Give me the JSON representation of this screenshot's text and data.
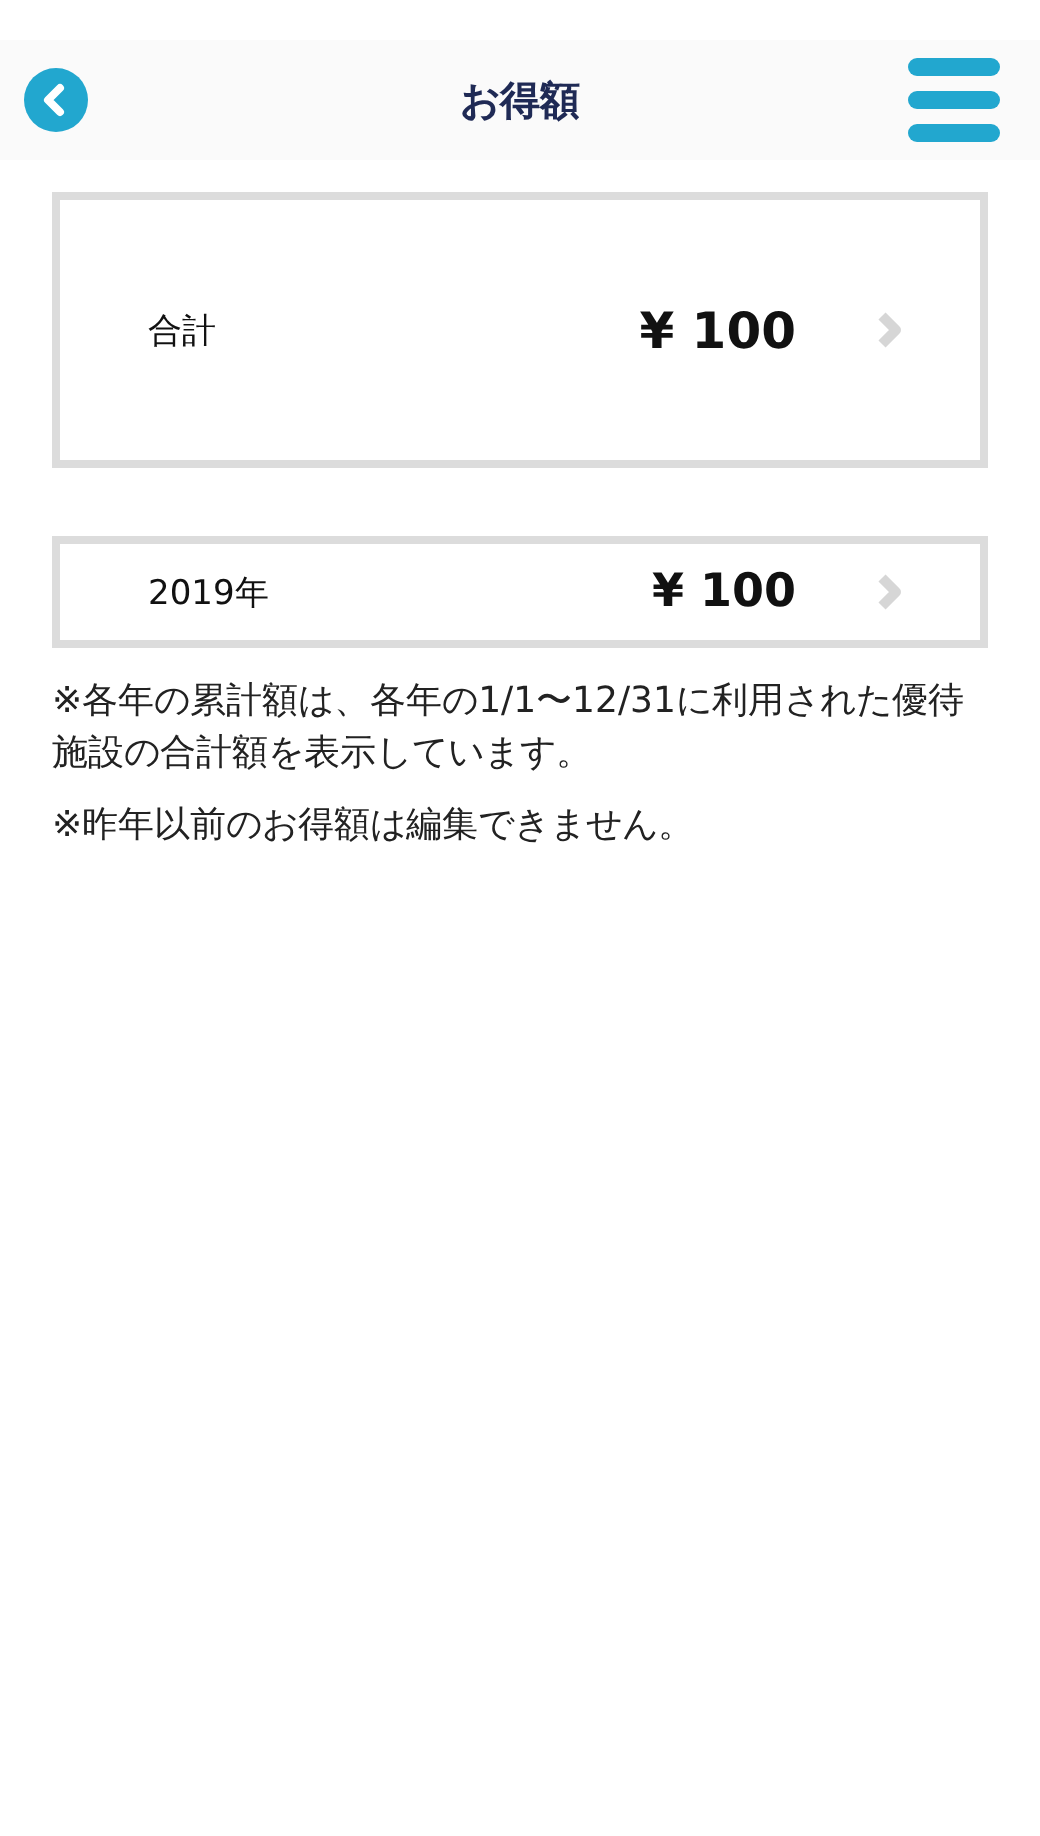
{
  "header": {
    "title": "お得額"
  },
  "rows": [
    {
      "kind": "total",
      "label": "合計",
      "amount": "¥ 100"
    },
    {
      "kind": "year",
      "label": "2019年",
      "amount": "¥ 100"
    }
  ],
  "notes": [
    "※各年の累計額は、各年の1/1〜12/31に利用された優待施設の合計額を表示しています。",
    "※昨年以前のお得額は編集できません。"
  ]
}
